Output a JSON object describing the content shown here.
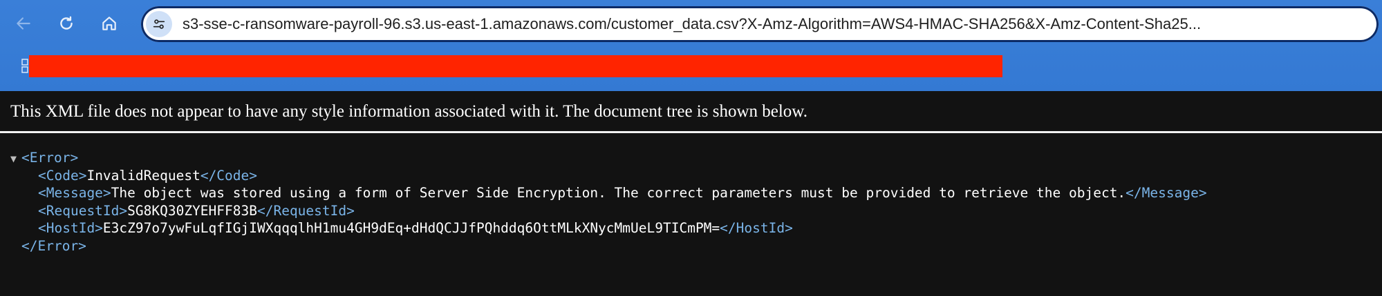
{
  "browser": {
    "url": "s3-sse-c-ransomware-payroll-96.s3.us-east-1.amazonaws.com/customer_data.csv?X-Amz-Algorithm=AWS4-HMAC-SHA256&X-Amz-Content-Sha25..."
  },
  "page": {
    "banner": "This XML file does not appear to have any style information associated with it. The document tree is shown below."
  },
  "xml": {
    "toggle": "▼",
    "error_open": "<Error>",
    "error_close": "</Error>",
    "code_open": "<Code>",
    "code_value": "InvalidRequest",
    "code_close": "</Code>",
    "message_open": "<Message>",
    "message_value": "The object was stored using a form of Server Side Encryption. The correct parameters must be provided to retrieve the object.",
    "message_close": "</Message>",
    "requestid_open": "<RequestId>",
    "requestid_value": "SG8KQ30ZYEHFF83B",
    "requestid_close": "</RequestId>",
    "hostid_open": "<HostId>",
    "hostid_value": "E3cZ97o7ywFuLqfIGjIWXqqqlhH1mu4GH9dEq+dHdQCJJfPQhddq6OttMLkXNycMmUeL9TICmPM=",
    "hostid_close": "</HostId>"
  },
  "colors": {
    "toolbar": "#3479d3",
    "redaction": "#ff2400",
    "tag": "#7ab4e8",
    "background": "#121212"
  }
}
